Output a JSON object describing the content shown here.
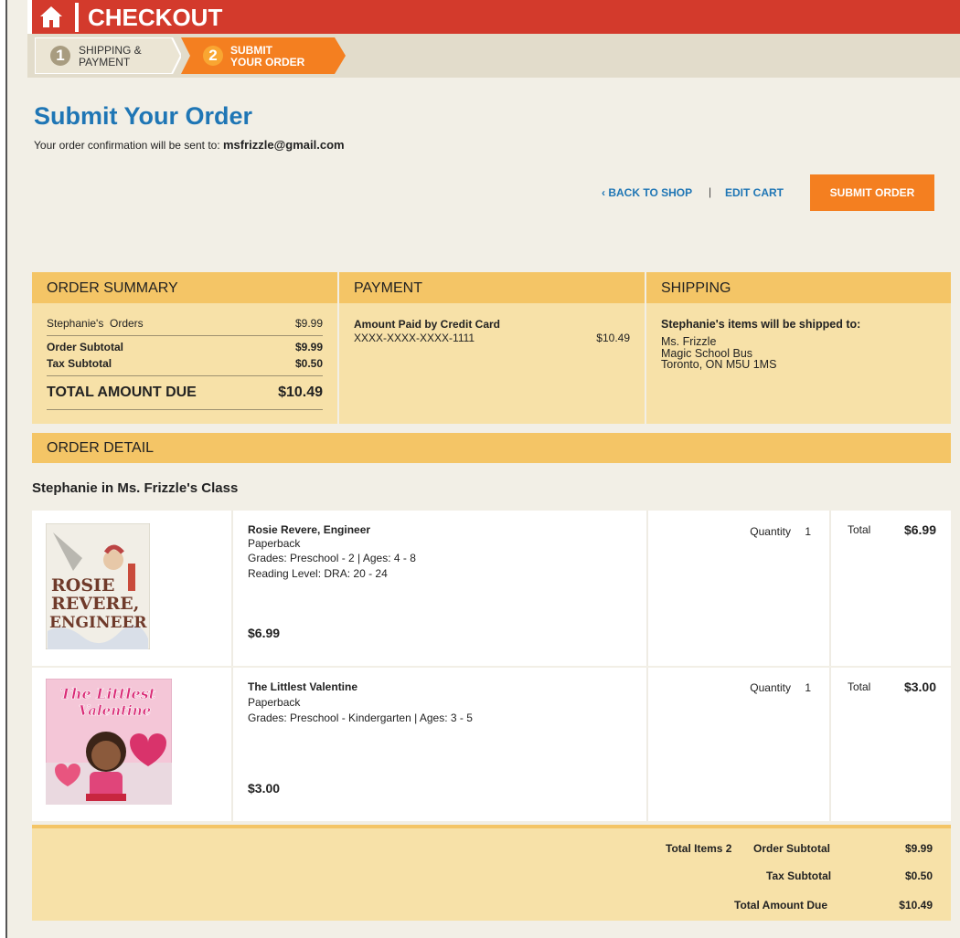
{
  "header": {
    "title": "CHECKOUT",
    "home_icon": "home-icon",
    "colors": {
      "bar": "#d33a2c",
      "step_active": "#f47f20"
    }
  },
  "steps": [
    {
      "number": "1",
      "line1": "SHIPPING &",
      "line2": "PAYMENT",
      "state": "done"
    },
    {
      "number": "2",
      "line1": "SUBMIT",
      "line2": "YOUR ORDER",
      "state": "active"
    }
  ],
  "page": {
    "title": "Submit Your Order",
    "confirm_prefix": "Your order confirmation will be sent to: ",
    "email": "msfrizzle@gmail.com"
  },
  "actions": {
    "back_label": "‹ BACK TO SHOP",
    "separator": "|",
    "edit_label": "EDIT CART",
    "submit_label": "SUBMIT ORDER"
  },
  "order_summary": {
    "heading": "ORDER SUMMARY",
    "orders_label": "Stephanie's  Orders",
    "orders_value": "$9.99",
    "subtotal_label": "Order Subtotal",
    "subtotal_value": "$9.99",
    "tax_label": "Tax Subtotal",
    "tax_value": "$0.50",
    "total_label": "TOTAL AMOUNT DUE",
    "total_value": "$10.49"
  },
  "payment": {
    "heading": "PAYMENT",
    "label": "Amount Paid by Credit Card",
    "card": "XXXX-XXXX-XXXX-1111",
    "amount": "$10.49"
  },
  "shipping": {
    "heading": "SHIPPING",
    "intro": "Stephanie's items will be shipped to:",
    "name": "Ms. Frizzle",
    "line1": "Magic School Bus",
    "line2": "Toronto, ON M5U 1MS"
  },
  "detail": {
    "heading": "ORDER DETAIL",
    "group_title": "Stephanie in Ms. Frizzle's Class",
    "items": [
      {
        "title": "Rosie Revere, Engineer",
        "format": "Paperback",
        "grades": "Grades: Preschool - 2 | Ages: 4 - 8",
        "reading": "Reading Level: DRA: 20 - 24",
        "price": "$6.99",
        "qty_label": "Quantity",
        "qty": "1",
        "total_label": "Total",
        "total": "$6.99",
        "cover_text": [
          "ROSIE",
          "REVERE,",
          "ENGINEER"
        ]
      },
      {
        "title": "The Littlest Valentine",
        "format": "Paperback",
        "grades": "Grades: Preschool - Kindergarten | Ages: 3 - 5",
        "reading": "",
        "price": "$3.00",
        "qty_label": "Quantity",
        "qty": "1",
        "total_label": "Total",
        "total": "$3.00",
        "cover_text": [
          "The Littlest",
          "Valentine"
        ]
      }
    ]
  },
  "totals": {
    "items_label": "Total Items 2",
    "subtotal_label": "Order Subtotal",
    "subtotal_value": "$9.99",
    "tax_label": "Tax Subtotal",
    "tax_value": "$0.50",
    "due_label": "Total Amount Due",
    "due_value": "$10.49"
  }
}
